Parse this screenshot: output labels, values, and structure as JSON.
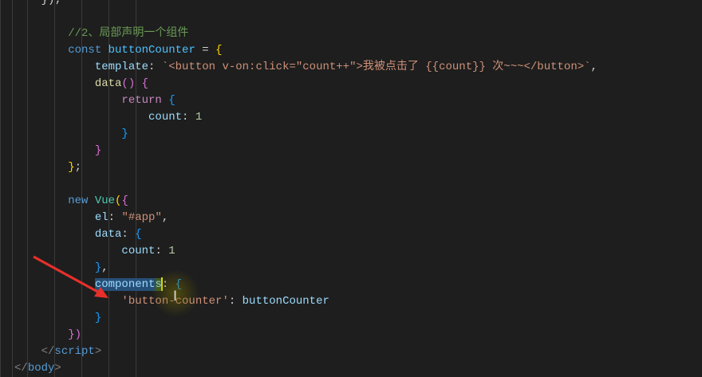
{
  "editor": {
    "lines": [
      [
        {
          "t": "    });",
          "c": "#d4d4d4"
        }
      ],
      [],
      [
        {
          "t": "        //2、局部声明一个组件",
          "c": "#6a9955"
        }
      ],
      [
        {
          "t": "        const ",
          "c": "#569cd6"
        },
        {
          "t": "buttonCounter",
          "c": "#4fc1ff"
        },
        {
          "t": " = ",
          "c": "#d4d4d4"
        },
        {
          "t": "{",
          "c": "#ffd700"
        }
      ],
      [
        {
          "t": "            template",
          "c": "#9cdcfe"
        },
        {
          "t": ": ",
          "c": "#d4d4d4"
        },
        {
          "t": "`<button v-on:click=\"count++\">我被点击了 {{count}} 次~~~</button>`",
          "c": "#ce9178"
        },
        {
          "t": ",",
          "c": "#d4d4d4"
        }
      ],
      [
        {
          "t": "            data",
          "c": "#dcdcaa"
        },
        {
          "t": "() ",
          "c": "#da70d6"
        },
        {
          "t": "{",
          "c": "#da70d6"
        }
      ],
      [
        {
          "t": "                return ",
          "c": "#c586c0"
        },
        {
          "t": "{",
          "c": "#179fff"
        }
      ],
      [
        {
          "t": "                    count",
          "c": "#9cdcfe"
        },
        {
          "t": ": ",
          "c": "#d4d4d4"
        },
        {
          "t": "1",
          "c": "#b5cea8"
        }
      ],
      [
        {
          "t": "                }",
          "c": "#179fff"
        }
      ],
      [
        {
          "t": "            }",
          "c": "#da70d6"
        }
      ],
      [
        {
          "t": "        }",
          "c": "#ffd700"
        },
        {
          "t": ";",
          "c": "#d4d4d4"
        }
      ],
      [],
      [
        {
          "t": "        new ",
          "c": "#569cd6"
        },
        {
          "t": "Vue",
          "c": "#4ec9b0"
        },
        {
          "t": "(",
          "c": "#ffd700"
        },
        {
          "t": "{",
          "c": "#da70d6"
        }
      ],
      [
        {
          "t": "            el",
          "c": "#9cdcfe"
        },
        {
          "t": ": ",
          "c": "#d4d4d4"
        },
        {
          "t": "\"#app\"",
          "c": "#ce9178"
        },
        {
          "t": ",",
          "c": "#d4d4d4"
        }
      ],
      [
        {
          "t": "            data",
          "c": "#9cdcfe"
        },
        {
          "t": ": ",
          "c": "#d4d4d4"
        },
        {
          "t": "{",
          "c": "#179fff"
        }
      ],
      [
        {
          "t": "                count",
          "c": "#9cdcfe"
        },
        {
          "t": ": ",
          "c": "#d4d4d4"
        },
        {
          "t": "1",
          "c": "#b5cea8"
        }
      ],
      [
        {
          "t": "            }",
          "c": "#179fff"
        },
        {
          "t": ",",
          "c": "#d4d4d4"
        }
      ],
      [
        {
          "t": "            ",
          "c": "#d4d4d4"
        },
        {
          "t": "component",
          "c": "#9cdcfe",
          "s": "sel"
        },
        {
          "t": "s",
          "c": "#9cdcfe",
          "s": "sel2"
        },
        {
          "t": "",
          "c": "#d4d4d4",
          "cursor": true
        },
        {
          "t": ": ",
          "c": "#d4d4d4"
        },
        {
          "t": "{",
          "c": "#179fff"
        }
      ],
      [
        {
          "t": "                'button-counter'",
          "c": "#ce9178"
        },
        {
          "t": ": ",
          "c": "#d4d4d4"
        },
        {
          "t": "buttonCounter",
          "c": "#9cdcfe"
        }
      ],
      [
        {
          "t": "            }",
          "c": "#179fff"
        }
      ],
      [
        {
          "t": "        })",
          "c": "#da70d6"
        }
      ],
      [
        {
          "t": "    </",
          "c": "#808080"
        },
        {
          "t": "script",
          "c": "#569cd6"
        },
        {
          "t": ">",
          "c": "#808080"
        }
      ],
      [
        {
          "t": "</",
          "c": "#808080"
        },
        {
          "t": "body",
          "c": "#569cd6"
        },
        {
          "t": ">",
          "c": "#808080"
        }
      ]
    ]
  },
  "annotation": {
    "arrow_color": "#e8302a"
  }
}
